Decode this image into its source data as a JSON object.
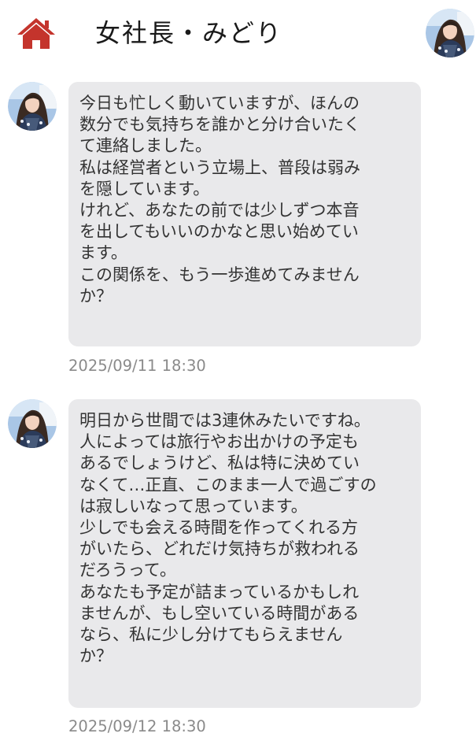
{
  "header": {
    "title": "女社長・みどり",
    "home_icon": "home-icon",
    "accent_color": "#c4342c"
  },
  "messages": [
    {
      "text": "今日も忙しく動いていますが、ほんの\n数分でも気持ちを誰かと分け合いたく\nて連絡しました。\n私は経営者という立場上、普段は弱み\nを隠しています。\nけれど、あなたの前では少しずつ本音\nを出してもいいのかなと思い始めてい\nます。\nこの関係を、もう一歩進めてみません\nか？",
      "timestamp": "2025/09/11 18:30"
    },
    {
      "text": "明日から世間では3連休みたいですね。\n人によっては旅行やお出かけの予定も\nあるでしょうけど、私は特に決めてい\nなくて…正直、このまま一人で過ごすの\nは寂しいなって思っています。\n少しでも会える時間を作ってくれる方\nがいたら、どれだけ気持ちが救われる\nだろうって。\nあなたも予定が詰まっているかもしれ\nませんが、もし空いている時間がある\nなら、私に少し分けてもらえません\nか？",
      "timestamp": "2025/09/12 18:30"
    }
  ]
}
